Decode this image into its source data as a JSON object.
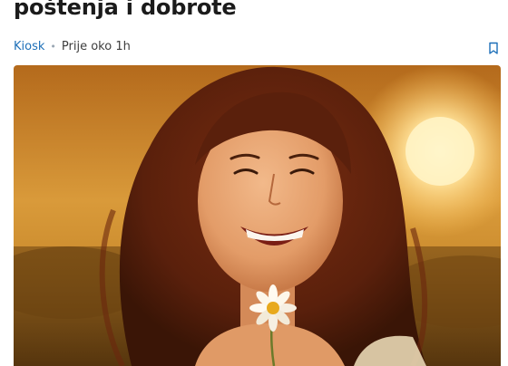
{
  "article": {
    "headline": "poštenja i dobrote",
    "category": "Kiosk",
    "separator": "•",
    "time_ago": "Prije oko 1h"
  },
  "icons": {
    "bookmark": "bookmark-icon"
  },
  "colors": {
    "category_link": "#1d6fb8",
    "headline": "#1b1b1b",
    "bookmark_icon": "#1d6fb8"
  }
}
